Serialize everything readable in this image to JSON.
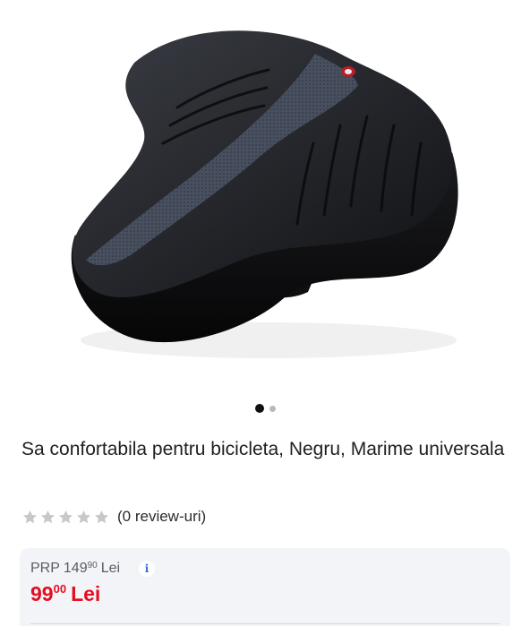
{
  "gallery": {
    "image_alt": "Sa confortabila pentru bicicleta, Negru",
    "slides": [
      {
        "state": "active"
      },
      {
        "state": "inactive"
      }
    ]
  },
  "product": {
    "title": "Sa confortabila pentru bicicleta, Negru, Marime universala"
  },
  "rating": {
    "stars_filled": 0,
    "stars_total": 5,
    "star_color": "#c7c7cc",
    "review_text": "(0 review-uri)"
  },
  "price": {
    "old_label": "PRP",
    "old_integer": "149",
    "old_decimals": "90",
    "old_currency": "Lei",
    "new_integer": "99",
    "new_decimals": "00",
    "new_currency": "Lei",
    "new_color": "#e40e20",
    "info_icon": "info-icon"
  }
}
